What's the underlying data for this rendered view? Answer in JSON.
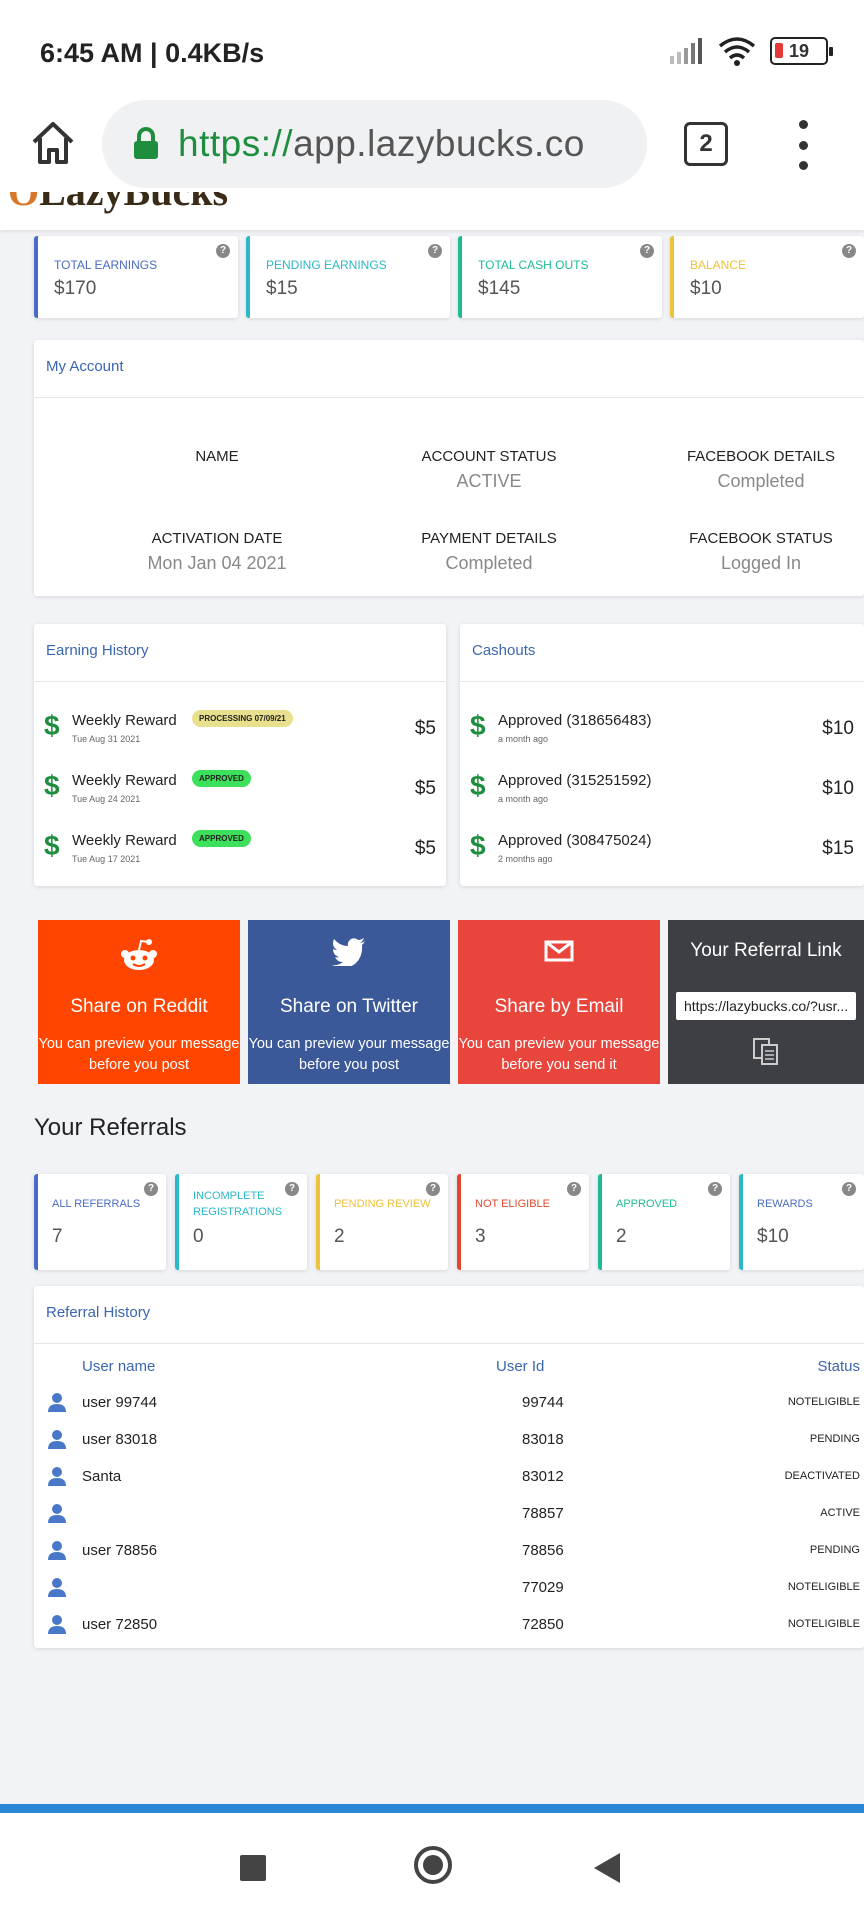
{
  "status_bar": {
    "time": "6:45 AM",
    "speed": "0.4KB/s",
    "battery": "19"
  },
  "browser": {
    "url_scheme": "https://",
    "url_host": "app.lazybucks.co",
    "tab_count": "2"
  },
  "logo": {
    "text": "LazyBucks"
  },
  "summary": [
    {
      "label": "Total Earnings",
      "value": "$170",
      "color": "#4a6cc2"
    },
    {
      "label": "Pending Earnings",
      "value": "$15",
      "color": "#2bb8c7"
    },
    {
      "label": "Total Cash Outs",
      "value": "$145",
      "color": "#1ebc94"
    },
    {
      "label": "Balance",
      "value": "$10",
      "color": "#eec23a"
    }
  ],
  "account": {
    "title": "My Account",
    "fields": [
      {
        "label": "Name",
        "value": ""
      },
      {
        "label": "Account Status",
        "value": "ACTIVE"
      },
      {
        "label": "Facebook Details",
        "value": "Completed"
      },
      {
        "label": "Activation Date",
        "value": "Mon Jan 04 2021"
      },
      {
        "label": "Payment Details",
        "value": "Completed"
      },
      {
        "label": "Facebook Status",
        "value": "Logged In"
      }
    ]
  },
  "earning_history": {
    "title": "Earning History",
    "rows": [
      {
        "title": "Weekly Reward",
        "date": "Tue Aug 31 2021",
        "badge": "PROCESSING 07/09/21",
        "amount": "$5"
      },
      {
        "title": "Weekly Reward",
        "date": "Tue Aug 24 2021",
        "badge": "APPROVED",
        "amount": "$5"
      },
      {
        "title": "Weekly Reward",
        "date": "Tue Aug 17 2021",
        "badge": "APPROVED",
        "amount": "$5"
      }
    ]
  },
  "cashouts": {
    "title": "Cashouts",
    "rows": [
      {
        "title": "Approved (318656483)",
        "when": "a month ago",
        "amount": "$10"
      },
      {
        "title": "Approved (315251592)",
        "when": "a month ago",
        "amount": "$10"
      },
      {
        "title": "Approved (308475024)",
        "when": "2 months ago",
        "amount": "$15"
      }
    ]
  },
  "share": {
    "reddit": {
      "title": "Share on Reddit",
      "sub": "You can preview your message before you post",
      "color": "#ff4500"
    },
    "twitter": {
      "title": "Share on Twitter",
      "sub": "You can preview your message before you post",
      "color": "#3b5998"
    },
    "email": {
      "title": "Share by Email",
      "sub": "You can preview your message before you send it",
      "color": "#e8453c"
    },
    "referral": {
      "title": "Your Referral Link",
      "link": "https://lazybucks.co/?usr...",
      "color": "#3d3f45"
    }
  },
  "referrals": {
    "title": "Your Referrals",
    "stats": [
      {
        "label": "All Referrals",
        "value": "7",
        "color": "#4a6cc2"
      },
      {
        "label": "Incomplete Registrations",
        "value": "0",
        "color": "#2bb8c7"
      },
      {
        "label": "Pending Review",
        "value": "2",
        "color": "#eec23a"
      },
      {
        "label": "Not Eligible",
        "value": "3",
        "color": "#e0482f"
      },
      {
        "label": "Approved",
        "value": "2",
        "color": "#1ebc94"
      },
      {
        "label": "Rewards",
        "value": "$10",
        "color": "#2bb8c7"
      }
    ]
  },
  "referral_history": {
    "title": "Referral History",
    "columns": {
      "user": "User name",
      "id": "User Id",
      "status": "Status"
    },
    "rows": [
      {
        "name": "user 99744",
        "id": "99744",
        "status": "NOTELIGIBLE"
      },
      {
        "name": "user 83018",
        "id": "83018",
        "status": "PENDING"
      },
      {
        "name": "Santa",
        "id": "83012",
        "status": "DEACTIVATED"
      },
      {
        "name": "",
        "id": "78857",
        "status": "ACTIVE"
      },
      {
        "name": "user 78856",
        "id": "78856",
        "status": "PENDING"
      },
      {
        "name": "",
        "id": "77029",
        "status": "NOTELIGIBLE"
      },
      {
        "name": "user 72850",
        "id": "72850",
        "status": "NOTELIGIBLE"
      }
    ]
  }
}
